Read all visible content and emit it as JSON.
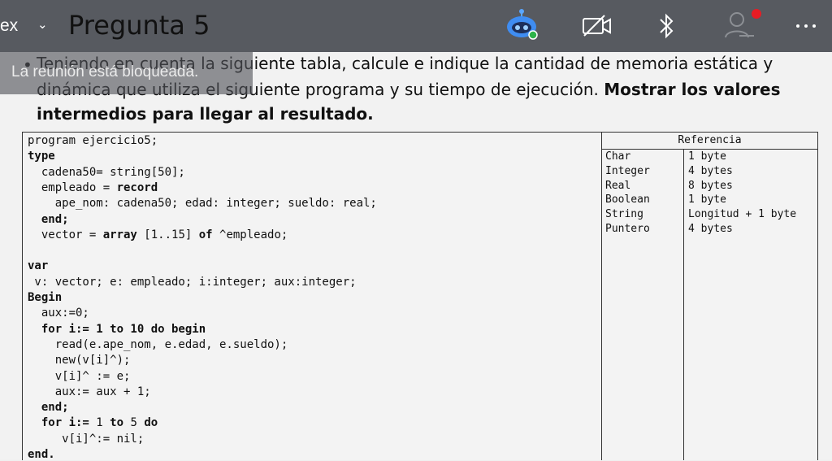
{
  "topbar": {
    "app_name": "ex",
    "page_title": "Pregunta 5",
    "icons": [
      "assistant-bot-icon",
      "video-off-icon",
      "bluetooth-icon",
      "participants-icon",
      "more-icon"
    ],
    "colors": {
      "bar": "#575a60",
      "alert_dot": "#e81c24",
      "status_dot": "#2db34a"
    }
  },
  "banner": {
    "text": "La reunión está bloqueada."
  },
  "slide": {
    "bullet": "•",
    "question_line1": "Teniendo en cuenta la siguiente tabla, calcule e indique la cantidad de memoria estática y",
    "question_line2": "dinámica que utiliza el siguiente programa y su tiempo de ejecución.",
    "question_line2_bold": "Mostrar los valores",
    "question_line3_bold": "intermedios para llegar al resultado."
  },
  "code": [
    [
      "program ejercicio5;"
    ],
    [
      {
        "b": "type"
      }
    ],
    [
      "  cadena50= string[50];"
    ],
    [
      "  empleado = ",
      {
        "b": "record"
      }
    ],
    [
      "    ape_nom: cadena50; edad: integer; sueldo: real;"
    ],
    [
      "  ",
      {
        "b": "end;"
      }
    ],
    [
      "  vector = ",
      {
        "b": "array"
      },
      " [1..15] ",
      {
        "b": "of"
      },
      " ^empleado;"
    ],
    [
      ""
    ],
    [
      {
        "b": "var"
      }
    ],
    [
      " v: vector; e: empleado; i:integer; aux:integer;"
    ],
    [
      {
        "b": "Begin"
      }
    ],
    [
      "  aux:=0;"
    ],
    [
      "  ",
      {
        "b": "for i:= 1 to 10 do begin"
      }
    ],
    [
      "    read(e.ape_nom, e.edad, e.sueldo);"
    ],
    [
      "    new(v[i]^);"
    ],
    [
      "    v[i]^ := e;"
    ],
    [
      "    aux:= aux + 1;"
    ],
    [
      "  ",
      {
        "b": "end;"
      }
    ],
    [
      "  ",
      {
        "b": "for i:="
      },
      " 1 ",
      {
        "b": "to"
      },
      " 5 ",
      {
        "b": "do"
      }
    ],
    [
      "     v[i]^:= nil;"
    ],
    [
      {
        "b": "end."
      }
    ]
  ],
  "reference": {
    "header": "Referencia",
    "rows": [
      {
        "type": "Char",
        "size": "1 byte"
      },
      {
        "type": "Integer",
        "size": "4 bytes"
      },
      {
        "type": "Real",
        "size": "8 bytes"
      },
      {
        "type": "Boolean",
        "size": "1 byte"
      },
      {
        "type": "String",
        "size": "Longitud + 1 byte"
      },
      {
        "type": "Puntero",
        "size": "4 bytes"
      }
    ]
  }
}
